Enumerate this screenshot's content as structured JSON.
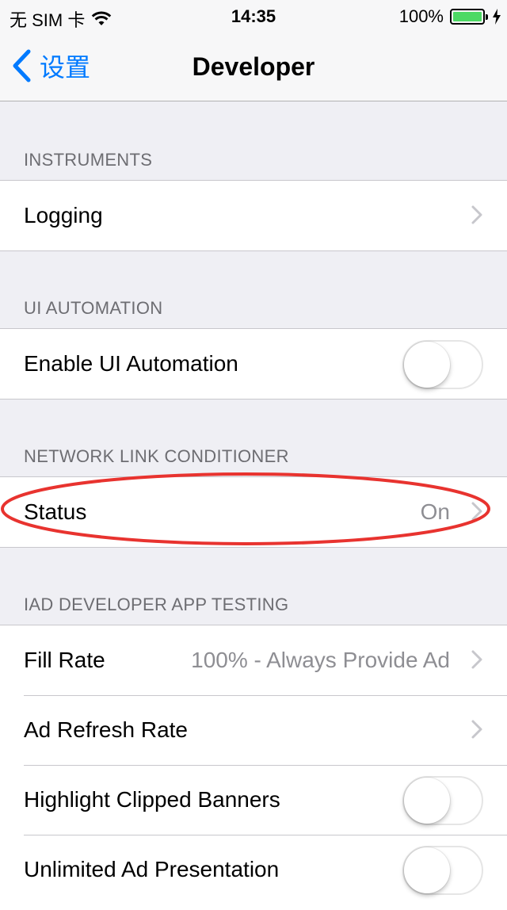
{
  "status_bar": {
    "carrier": "无 SIM 卡",
    "time": "14:35",
    "battery_percent": "100%",
    "battery_level": 1.0,
    "wifi_icon": "wifi-icon",
    "charging_icon": "charging-bolt-icon"
  },
  "nav": {
    "back_label": "设置",
    "title": "Developer",
    "accent_color": "#007aff"
  },
  "sections": {
    "instruments": {
      "header": "INSTRUMENTS",
      "rows": [
        {
          "label": "Logging",
          "accessory": "chevron"
        }
      ]
    },
    "ui_automation": {
      "header": "UI AUTOMATION",
      "rows": [
        {
          "label": "Enable UI Automation",
          "accessory": "toggle",
          "on": false
        }
      ]
    },
    "network_link": {
      "header": "NETWORK LINK CONDITIONER",
      "rows": [
        {
          "label": "Status",
          "value": "On",
          "accessory": "chevron",
          "highlighted": true
        }
      ]
    },
    "iad": {
      "header": "IAD DEVELOPER APP TESTING",
      "rows": [
        {
          "label": "Fill Rate",
          "value": "100% - Always Provide Ad",
          "accessory": "chevron"
        },
        {
          "label": "Ad Refresh Rate",
          "accessory": "chevron"
        },
        {
          "label": "Highlight Clipped Banners",
          "accessory": "toggle",
          "on": false
        },
        {
          "label": "Unlimited Ad Presentation",
          "accessory": "toggle",
          "on": false
        }
      ]
    }
  },
  "annotation_color": "#e8332f"
}
